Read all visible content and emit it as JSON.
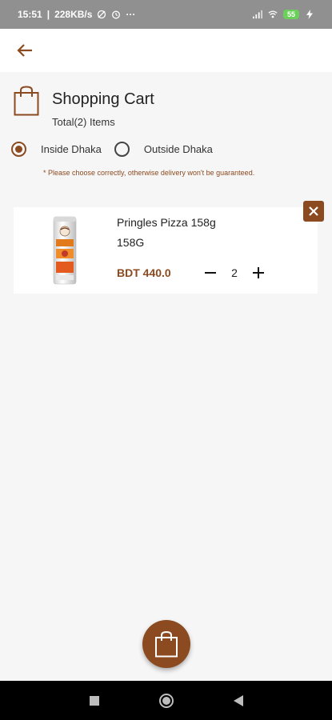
{
  "status_bar": {
    "time": "15:51",
    "speed": "228KB/s",
    "dots": "···",
    "battery": "55"
  },
  "header": {
    "title": "Shopping Cart",
    "total": "Total(2) Items"
  },
  "delivery": {
    "options": [
      {
        "label": "Inside Dhaka",
        "selected": true
      },
      {
        "label": "Outside Dhaka",
        "selected": false
      }
    ],
    "warning": "* Please choose correctly, otherwise delivery won't be guaranteed."
  },
  "cart_items": [
    {
      "name": "Pringles Pizza 158g",
      "weight": "158G",
      "price": "BDT 440.0",
      "quantity": "2"
    }
  ],
  "icons": {
    "back": "arrow-left-icon",
    "bag": "shopping-bag-icon",
    "remove": "close-icon",
    "minus": "minus-icon",
    "plus": "plus-icon",
    "fab": "shopping-bag-icon"
  },
  "colors": {
    "accent": "#8b4a1f",
    "status_bar": "#909090",
    "nav_bar": "#000000",
    "background": "#f6f6f6"
  }
}
